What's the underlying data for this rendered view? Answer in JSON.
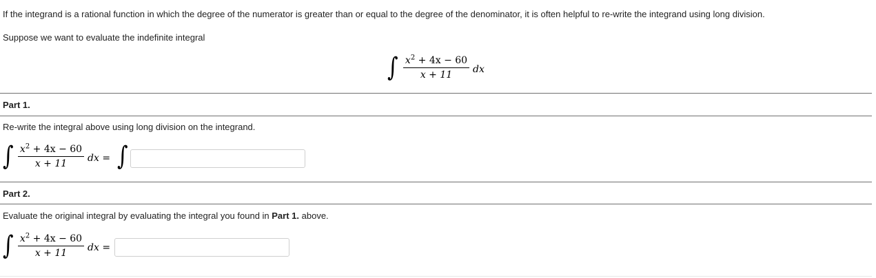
{
  "intro": {
    "line1": "If the integrand is a rational function in which the degree of the numerator is greater than or equal to the degree of the denominator, it is often helpful to re-write the integrand using long division.",
    "line2": "Suppose we want to evaluate the indefinite integral"
  },
  "integral": {
    "sign": "∫",
    "numerator_var": "x",
    "numerator_exp": "2",
    "numerator_rest": " + 4x − 60",
    "denominator": "x + 11",
    "differential": "dx",
    "equals": "="
  },
  "part1": {
    "title": "Part 1.",
    "instruction": "Re-write the integral above using long division on the integrand.",
    "answer_value": ""
  },
  "part2": {
    "title": "Part 2.",
    "instruction_pre": "Evaluate the original integral by evaluating the integral you found in ",
    "instruction_bold": "Part 1.",
    "instruction_post": " above.",
    "answer_value": ""
  }
}
